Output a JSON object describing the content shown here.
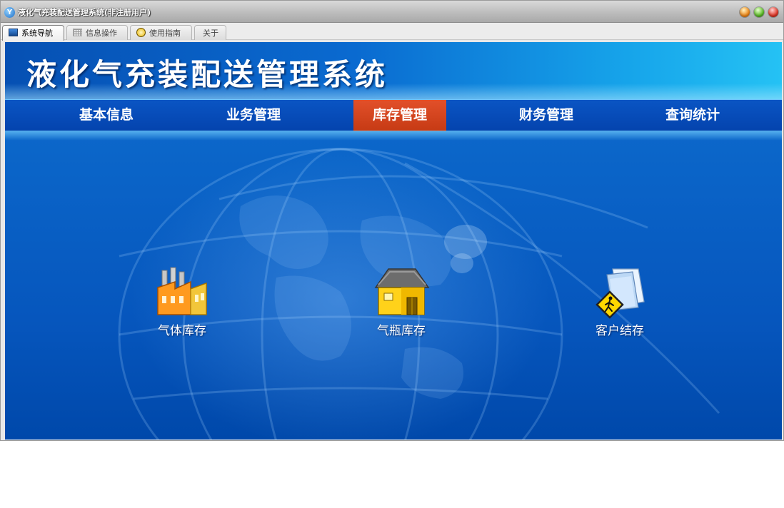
{
  "window": {
    "title": "液化气充装配送管理系统(非注册用户)"
  },
  "tabs": [
    {
      "label": "系统导航",
      "icon": "monitor-icon",
      "active": true
    },
    {
      "label": "信息操作",
      "icon": "grid-icon",
      "active": false
    },
    {
      "label": "使用指南",
      "icon": "guide-icon",
      "active": false
    },
    {
      "label": "关于",
      "icon": "",
      "active": false
    }
  ],
  "banner": {
    "title": "液化气充装配送管理系统"
  },
  "nav": {
    "items": [
      {
        "label": "基本信息",
        "active": false
      },
      {
        "label": "业务管理",
        "active": false
      },
      {
        "label": "库存管理",
        "active": true
      },
      {
        "label": "财务管理",
        "active": false
      },
      {
        "label": "查询统计",
        "active": false
      }
    ],
    "active_color": "#d5451c"
  },
  "features": [
    {
      "label": "气体库存",
      "icon": "factory-icon"
    },
    {
      "label": "气瓶库存",
      "icon": "warehouse-icon"
    },
    {
      "label": "客户结存",
      "icon": "documents-icon"
    }
  ],
  "colors": {
    "background_blue": "#0a5fc4",
    "nav_blue": "#0647b0"
  }
}
